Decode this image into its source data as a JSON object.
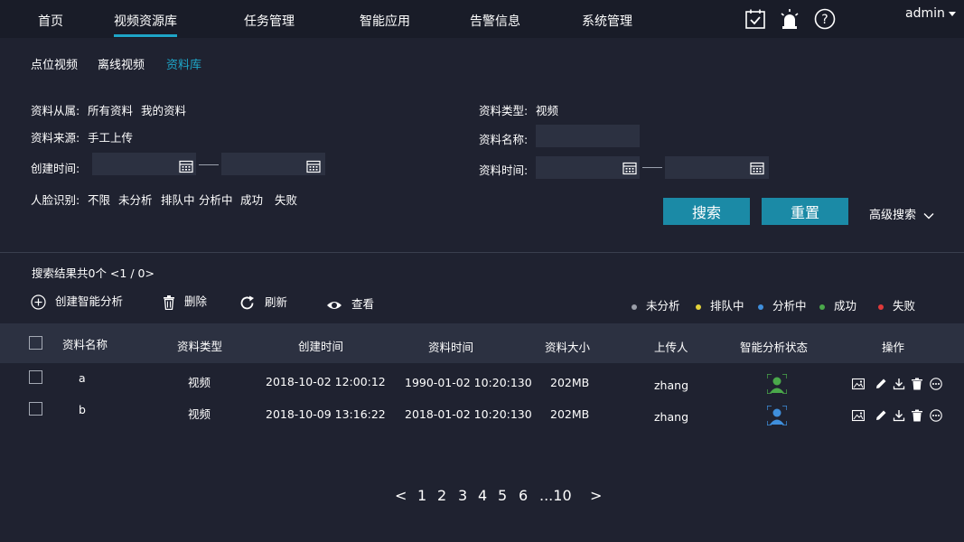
{
  "nav": {
    "items": [
      "首页",
      "视频资源库",
      "任务管理",
      "智能应用",
      "告警信息",
      "系统管理"
    ],
    "user": "admin"
  },
  "subnav": [
    "点位视频",
    "离线视频",
    "资料库"
  ],
  "filters": {
    "owner_label": "资料从属:",
    "owner_opts": [
      "所有资料",
      "我的资料"
    ],
    "source_label": "资料来源:",
    "source_value": "手工上传",
    "created_label": "创建时间:",
    "face_label": "人脸识别:",
    "face_opts": [
      "不限",
      "未分析",
      "排队中",
      "分析中",
      "成功",
      "失败"
    ],
    "type_label": "资料类型:",
    "type_value": "视频",
    "name_label": "资料名称:",
    "time_label": "资料时间:"
  },
  "buttons": {
    "search": "搜索",
    "reset": "重置",
    "advanced": "高级搜索"
  },
  "summary": "搜索结果共0个  <1 / 0>",
  "toolbar": {
    "create": "创建智能分析",
    "delete": "删除",
    "refresh": "刷新",
    "view": "查看"
  },
  "legend": [
    {
      "label": "未分析",
      "color": "#9a9ea8"
    },
    {
      "label": "排队中",
      "color": "#e3d23a"
    },
    {
      "label": "分析中",
      "color": "#3f8fdc"
    },
    {
      "label": "成功",
      "color": "#4aa84a"
    },
    {
      "label": "失败",
      "color": "#e03a3a"
    }
  ],
  "table": {
    "headers": [
      "资料名称",
      "资料类型",
      "创建时间",
      "资料时间",
      "资料大小",
      "上传人",
      "智能分析状态",
      "操作"
    ],
    "rows": [
      {
        "name": "a",
        "type": "视频",
        "created": "2018-10-02 12:00:12",
        "time": "1990-01-02 10:20:130",
        "size": "202MB",
        "uploader": "zhang",
        "status_color": "#4aa84a"
      },
      {
        "name": "b",
        "type": "视频",
        "created": "2018-10-09 13:16:22",
        "time": "2018-01-02 10:20:130",
        "size": "202MB",
        "uploader": "zhang",
        "status_color": "#3f8fdc"
      }
    ]
  },
  "pager": {
    "prev": "<",
    "pages": [
      "1",
      "2",
      "3",
      "4",
      "5",
      "6",
      "...10"
    ],
    "next": ">"
  },
  "colors": {
    "accent": "#1ea5c7",
    "button": "#1b8aa6",
    "bg": "#1f2230"
  }
}
